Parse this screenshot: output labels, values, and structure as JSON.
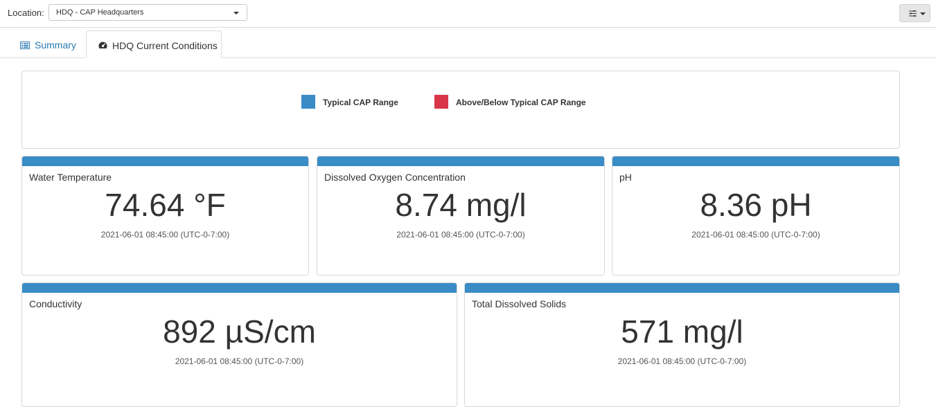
{
  "location": {
    "label": "Location:",
    "selected": "HDQ - CAP Headquarters"
  },
  "toolbar": {
    "settings_icon": "sliders-icon"
  },
  "tabs": [
    {
      "label": "Summary",
      "icon": "list-icon",
      "active": false
    },
    {
      "label": "HDQ Current Conditions",
      "icon": "dashboard-icon",
      "active": true
    }
  ],
  "legend": {
    "typical": {
      "label": "Typical CAP Range",
      "color": "#3a8cc6"
    },
    "above_below": {
      "label": "Above/Below Typical CAP Range",
      "color": "#d9364a"
    }
  },
  "metrics": {
    "water_temperature": {
      "title": "Water Temperature",
      "value": "74.64 °F",
      "timestamp": "2021-06-01 08:45:00 (UTC-0-7:00)",
      "status_color": "#3a8cc6"
    },
    "dissolved_oxygen": {
      "title": "Dissolved Oxygen Concentration",
      "value": "8.74 mg/l",
      "timestamp": "2021-06-01 08:45:00 (UTC-0-7:00)",
      "status_color": "#3a8cc6"
    },
    "ph": {
      "title": "pH",
      "value": "8.36 pH",
      "timestamp": "2021-06-01 08:45:00 (UTC-0-7:00)",
      "status_color": "#3a8cc6"
    },
    "conductivity": {
      "title": "Conductivity",
      "value": "892 µS/cm",
      "timestamp": "2021-06-01 08:45:00 (UTC-0-7:00)",
      "status_color": "#3a8cc6"
    },
    "tds": {
      "title": "Total Dissolved Solids",
      "value": "571 mg/l",
      "timestamp": "2021-06-01 08:45:00 (UTC-0-7:00)",
      "status_color": "#3a8cc6"
    }
  }
}
